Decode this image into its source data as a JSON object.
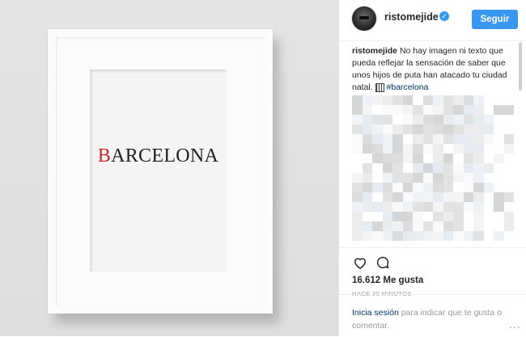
{
  "post_image": {
    "print_text_accent": "B",
    "print_text_rest": "ARCELONA",
    "accent_color": "#c92a2a"
  },
  "header": {
    "username": "ristomejide",
    "verified_icon": "verified-check-icon",
    "follow_label": "Seguir",
    "follow_color": "#3897f0"
  },
  "caption": {
    "username": "ristomejide",
    "text": "No hay imagen ni texto que pueda reflejar la sensación de saber que unos hijos de puta han atacado tu ciudad natal.",
    "emoji_icon": "flag-emoji-icon",
    "hashtag": "#barcelona"
  },
  "actions": {
    "like_icon": "heart-icon",
    "comment_icon": "comment-icon",
    "likes": "16.612 Me gusta",
    "time_ago": "HACE 30 MINUTOS"
  },
  "footer": {
    "login_link": "Inicia sesión",
    "login_text": " para indicar que te gusta o comentar.",
    "more_icon": "more-options-icon",
    "more_label": "..."
  }
}
